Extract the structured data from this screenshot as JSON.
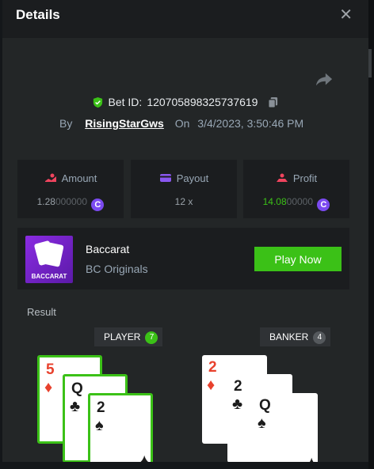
{
  "header": {
    "title": "Details",
    "close_glyph": "✕"
  },
  "bet": {
    "id_label": "Bet ID:",
    "id_value": "120705898325737619"
  },
  "by": {
    "by_label": "By",
    "username": "RisingStarGws",
    "on_label": "On",
    "datetime": "3/4/2023, 3:50:46 PM"
  },
  "stats": {
    "amount": {
      "label": "Amount",
      "value_main": "1.28",
      "value_dim": "000000"
    },
    "payout": {
      "label": "Payout",
      "value": "12 x"
    },
    "profit": {
      "label": "Profit",
      "value_main": "14.08",
      "value_dim": "00000"
    },
    "coin_glyph": "C"
  },
  "game": {
    "thumb_text": "BACCARAT",
    "name": "Baccarat",
    "provider": "BC Originals",
    "play_label": "Play Now"
  },
  "result": {
    "label": "Result",
    "player": {
      "label": "PLAYER",
      "score": "7"
    },
    "banker": {
      "label": "BANKER",
      "score": "4"
    },
    "player_cards": [
      {
        "rank": "5",
        "suit": "♦"
      },
      {
        "rank": "Q",
        "suit": "♣"
      },
      {
        "rank": "2",
        "suit": "♠"
      }
    ],
    "banker_cards": [
      {
        "rank": "2",
        "suit": "♦"
      },
      {
        "rank": "2",
        "suit": "♣"
      },
      {
        "rank": "Q",
        "suit": "♠"
      }
    ]
  },
  "colors": {
    "accent_green": "#3bc117",
    "coin_purple": "#7b4af0",
    "suit_red": "#e8412d",
    "panel": "#1b1d1f"
  },
  "icons": [
    "close-icon",
    "share-icon",
    "shield-check-icon",
    "copy-icon",
    "amount-icon",
    "payout-icon",
    "profit-icon",
    "coin-icon"
  ]
}
